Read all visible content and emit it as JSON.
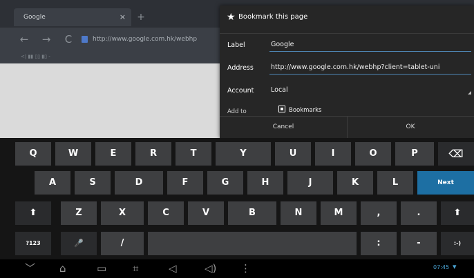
{
  "browser": {
    "tab_title": "Google",
    "tab_close": "×",
    "new_tab": "+",
    "url": "http://www.google.com.hk/webhp",
    "bookmarks_bar": "<| ▮▮ ▯▯ ▮▯ -"
  },
  "dialog": {
    "title": "Bookmark this page",
    "label_label": "Label",
    "label_value": "Google",
    "address_label": "Address",
    "address_value": "http://www.google.com.hk/webhp?client=tablet-uni",
    "account_label": "Account",
    "account_value": "Local",
    "add_to_label": "Add to",
    "add_to_value": "Bookmarks",
    "cancel_label": "Cancel",
    "ok_label": "OK"
  },
  "keyboard": {
    "row1": [
      "Q",
      "W",
      "E",
      "R",
      "T",
      "Y",
      "U",
      "I",
      "O",
      "P"
    ],
    "row2": [
      "A",
      "S",
      "D",
      "F",
      "G",
      "H",
      "J",
      "K",
      "L"
    ],
    "row3": [
      "Z",
      "X",
      "C",
      "V",
      "B",
      "N",
      "M",
      ",",
      "."
    ],
    "next_label": "Next",
    "numbers_label": "?123",
    "mic_label": "🎤",
    "slash_label": "/",
    "colon_label": ":",
    "dash_label": "-",
    "smiley_label": ":-)",
    "backspace_label": "⌫",
    "shift_label": "⬆"
  },
  "system_bar": {
    "clock": "07:45",
    "wifi": "▾"
  },
  "icons": {
    "star": "★",
    "back": "←",
    "forward": "→",
    "reload": "C",
    "nav_down": "﹀",
    "home": "⌂",
    "recents": "▭",
    "screenshot": "⌗",
    "vol_down": "◁",
    "vol_up": "◁)",
    "menu": "⋮"
  }
}
